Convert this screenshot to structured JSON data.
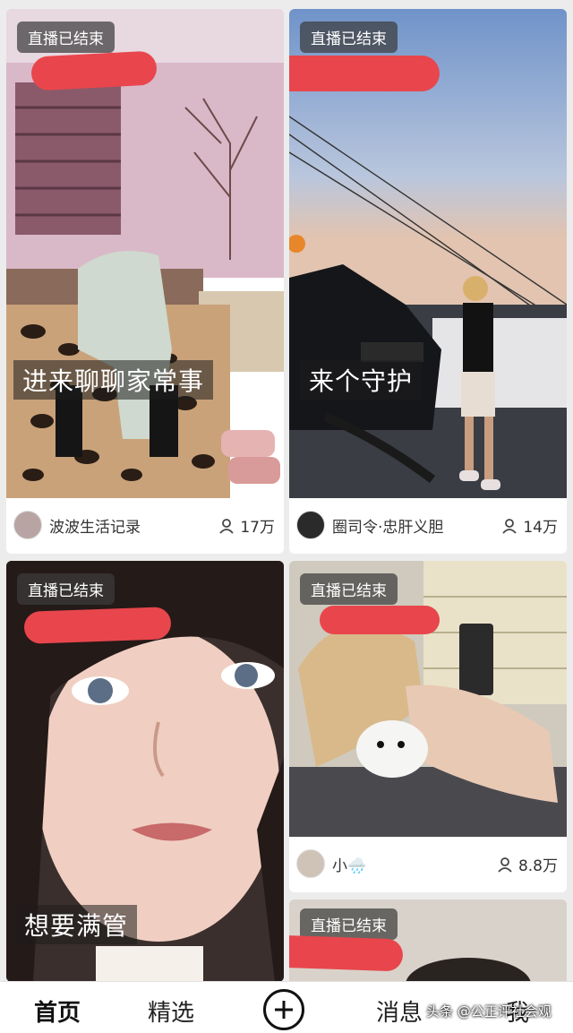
{
  "cards": [
    {
      "badge": "直播已结束",
      "caption": "进来聊聊家常事",
      "author": "波波生活记录",
      "viewers": "17万"
    },
    {
      "badge": "直播已结束",
      "caption": "来个守护",
      "author": "圈司令·忠肝义胆",
      "viewers": "14万"
    },
    {
      "badge": "直播已结束",
      "caption": "想要满管",
      "author": "",
      "viewers": ""
    },
    {
      "badge": "直播已结束",
      "caption": "",
      "author": "小🌧️",
      "viewers": "8.8万"
    },
    {
      "badge": "直播已结束",
      "caption": "",
      "author": "",
      "viewers": ""
    }
  ],
  "nav": {
    "home": "首页",
    "featured": "精选",
    "add": "+",
    "messages": "消息",
    "me": "我"
  },
  "watermark": "头条 @公正评社会观",
  "colors": {
    "redaction": "#e8464c",
    "badge_bg": "#3c3c3c",
    "background": "#ececec"
  }
}
